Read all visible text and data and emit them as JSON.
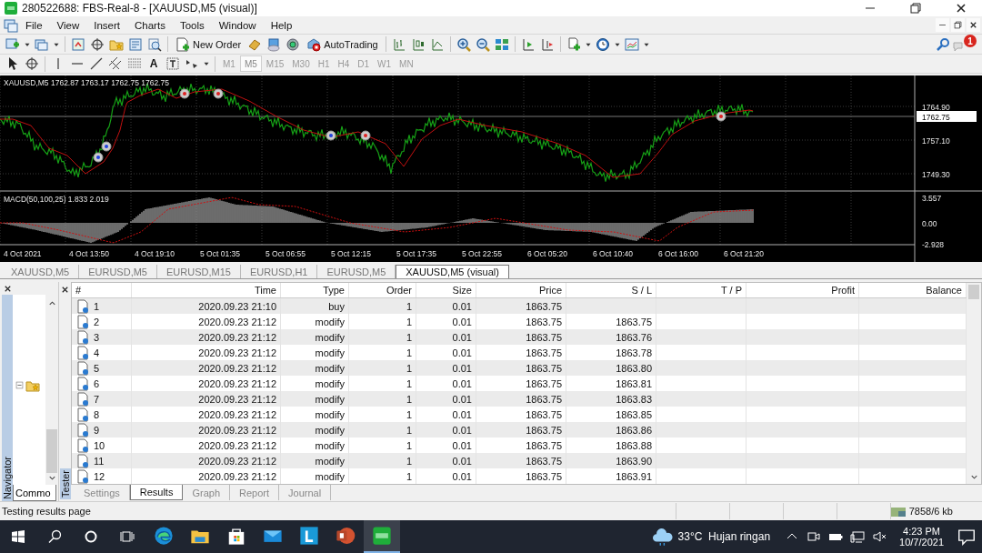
{
  "window": {
    "title": "280522688: FBS-Real-8 - [XAUUSD,M5 (visual)]"
  },
  "menu": [
    "File",
    "View",
    "Insert",
    "Charts",
    "Tools",
    "Window",
    "Help"
  ],
  "toolbar": {
    "new_order": "New Order",
    "autotrading": "AutoTrading",
    "notification_count": "1"
  },
  "drawing_tools": {
    "text_tool": "A"
  },
  "timeframes": [
    {
      "label": "M1",
      "selected": false
    },
    {
      "label": "M5",
      "selected": true
    },
    {
      "label": "M15",
      "selected": false
    },
    {
      "label": "M30",
      "selected": false
    },
    {
      "label": "H1",
      "selected": false
    },
    {
      "label": "H4",
      "selected": false
    },
    {
      "label": "D1",
      "selected": false
    },
    {
      "label": "W1",
      "selected": false
    },
    {
      "label": "MN",
      "selected": false
    }
  ],
  "chart": {
    "symbol_info": "XAUUSD,M5  1762.87 1763.17 1762.75 1762.75",
    "price_ticks": [
      "1764.90",
      "1757.10",
      "1749.30"
    ],
    "current_price": "1762.75",
    "macd_label": "MACD(50,100,25) 1.833 2.019",
    "macd_ticks": [
      "3.557",
      "0.00",
      "-2.928"
    ],
    "time_labels": [
      "4 Oct 2021",
      "4 Oct 13:50",
      "4 Oct 19:10",
      "5 Oct 01:35",
      "5 Oct 06:55",
      "5 Oct 12:15",
      "5 Oct 17:35",
      "5 Oct 22:55",
      "6 Oct 05:20",
      "6 Oct 10:40",
      "6 Oct 16:00",
      "6 Oct 21:20"
    ]
  },
  "chart_tabs": [
    {
      "label": "XAUUSD,M5",
      "selected": false
    },
    {
      "label": "EURUSD,M5",
      "selected": false
    },
    {
      "label": "EURUSD,M15",
      "selected": false
    },
    {
      "label": "EURUSD,H1",
      "selected": false
    },
    {
      "label": "EURUSD,M5",
      "selected": false
    },
    {
      "label": "XAUUSD,M5 (visual)",
      "selected": true
    }
  ],
  "navigator": {
    "title": "Navigator",
    "tab": "Commo"
  },
  "tester": {
    "title": "Tester",
    "columns": [
      "#",
      "Time",
      "Type",
      "Order",
      "Size",
      "Price",
      "S / L",
      "T / P",
      "Profit",
      "Balance"
    ],
    "rows": [
      [
        "1",
        "2020.09.23 21:10",
        "buy",
        "1",
        "0.01",
        "1863.75",
        "",
        "",
        "",
        ""
      ],
      [
        "2",
        "2020.09.23 21:12",
        "modify",
        "1",
        "0.01",
        "1863.75",
        "1863.75",
        "",
        "",
        ""
      ],
      [
        "3",
        "2020.09.23 21:12",
        "modify",
        "1",
        "0.01",
        "1863.75",
        "1863.76",
        "",
        "",
        ""
      ],
      [
        "4",
        "2020.09.23 21:12",
        "modify",
        "1",
        "0.01",
        "1863.75",
        "1863.78",
        "",
        "",
        ""
      ],
      [
        "5",
        "2020.09.23 21:12",
        "modify",
        "1",
        "0.01",
        "1863.75",
        "1863.80",
        "",
        "",
        ""
      ],
      [
        "6",
        "2020.09.23 21:12",
        "modify",
        "1",
        "0.01",
        "1863.75",
        "1863.81",
        "",
        "",
        ""
      ],
      [
        "7",
        "2020.09.23 21:12",
        "modify",
        "1",
        "0.01",
        "1863.75",
        "1863.83",
        "",
        "",
        ""
      ],
      [
        "8",
        "2020.09.23 21:12",
        "modify",
        "1",
        "0.01",
        "1863.75",
        "1863.85",
        "",
        "",
        ""
      ],
      [
        "9",
        "2020.09.23 21:12",
        "modify",
        "1",
        "0.01",
        "1863.75",
        "1863.86",
        "",
        "",
        ""
      ],
      [
        "10",
        "2020.09.23 21:12",
        "modify",
        "1",
        "0.01",
        "1863.75",
        "1863.88",
        "",
        "",
        ""
      ],
      [
        "11",
        "2020.09.23 21:12",
        "modify",
        "1",
        "0.01",
        "1863.75",
        "1863.90",
        "",
        "",
        ""
      ],
      [
        "12",
        "2020.09.23 21:12",
        "modify",
        "1",
        "0.01",
        "1863.75",
        "1863.91",
        "",
        "",
        ""
      ]
    ],
    "tabs": [
      {
        "label": "Settings",
        "selected": false
      },
      {
        "label": "Results",
        "selected": true
      },
      {
        "label": "Graph",
        "selected": false
      },
      {
        "label": "Report",
        "selected": false
      },
      {
        "label": "Journal",
        "selected": false
      }
    ]
  },
  "status_bar": {
    "text": "Testing results page",
    "traffic": "7858/6 kb"
  },
  "taskbar": {
    "weather": "33°C  Hujan ringan",
    "time": "4:23 PM",
    "date": "10/7/2021"
  }
}
